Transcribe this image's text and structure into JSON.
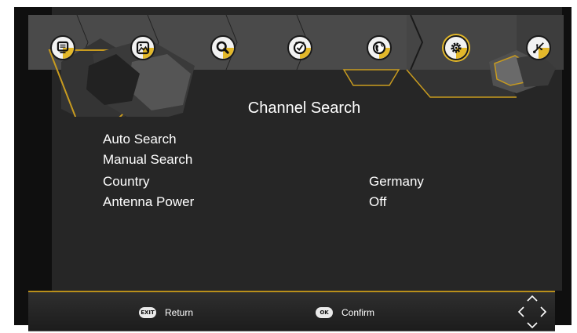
{
  "tabs": [
    {
      "name": "tab-program",
      "icon": "tv-screen-icon"
    },
    {
      "name": "tab-picture",
      "icon": "image-icon"
    },
    {
      "name": "tab-search",
      "icon": "search-icon"
    },
    {
      "name": "tab-time",
      "icon": "clock-icon"
    },
    {
      "name": "tab-option",
      "icon": "globe-icon"
    },
    {
      "name": "tab-system",
      "icon": "gear-icon",
      "active": true
    },
    {
      "name": "tab-usb",
      "icon": "usb-icon"
    }
  ],
  "colors": {
    "accent": "#e3b82a",
    "panel": "#262626",
    "text": "#ffffff"
  },
  "title": "Channel Search",
  "menu": {
    "auto_search": {
      "label": "Auto Search"
    },
    "manual_search": {
      "label": "Manual Search"
    },
    "country": {
      "label": "Country",
      "value": "Germany"
    },
    "antenna_power": {
      "label": "Antenna Power",
      "value": "Off"
    }
  },
  "footer": {
    "exit_key": "EXIT",
    "return_label": "Return",
    "ok_key": "OK",
    "confirm_label": "Confirm",
    "nav_icon": "dpad-arrows-icon"
  }
}
